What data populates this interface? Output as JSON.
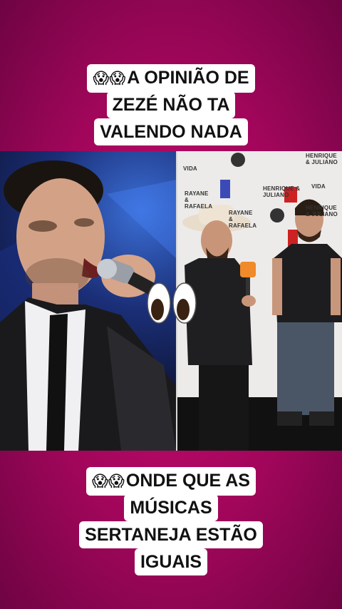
{
  "top_caption": {
    "emoji": "😱😱",
    "lines": [
      "A OPINIÃO DE",
      "ZEZÉ NÃO TA",
      "VALENDO NADA"
    ]
  },
  "bottom_caption": {
    "emoji": "😱😱",
    "lines": [
      "ONDE QUE AS",
      "MÚSICAS",
      "SERTANEJA ESTÃO",
      "IGUAIS"
    ]
  },
  "backdrop_logos": [
    "HENRIQUE & JULIANO",
    "VIDA",
    "RAYANE & RAFAELA",
    "HENRIQUE & JULIANO",
    "VIDA",
    "RAYANE & RAFAELA",
    "HENRIQUE & JULIANO"
  ],
  "icons": {
    "eyes": "eyes-emoji-icon",
    "shocked": "face-screaming-in-fear-icon"
  }
}
